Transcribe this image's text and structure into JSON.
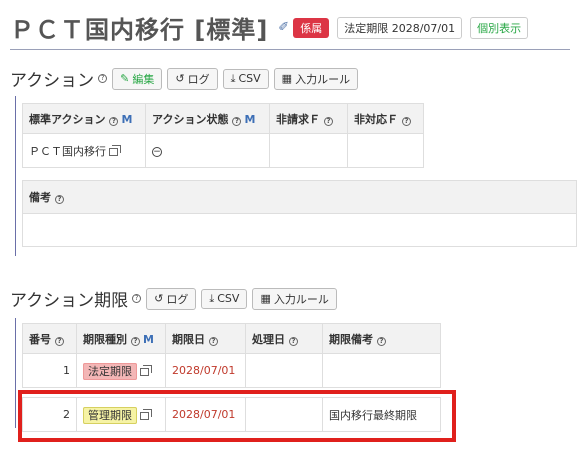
{
  "header": {
    "title": "ＰＣＴ国内移行 [標準]",
    "status_badge": "係属",
    "legal_deadline_label": "法定期限 2028/07/01",
    "individual_view_label": "個別表示"
  },
  "actions_section": {
    "title": "アクション",
    "buttons": {
      "edit": "編集",
      "log": "ログ",
      "csv": "CSV",
      "input_rule": "入力ルール"
    },
    "columns": {
      "standard_action": "標準アクション",
      "action_status": "アクション状態",
      "non_claim": "非請求Ｆ",
      "non_response": "非対応Ｆ",
      "m_marker": "M"
    },
    "row": {
      "standard_action": "ＰＣＴ国内移行",
      "action_status_icon": "minus-circle-icon"
    },
    "remarks_label": "備考"
  },
  "deadlines_section": {
    "title": "アクション期限",
    "buttons": {
      "log": "ログ",
      "csv": "CSV",
      "input_rule": "入力ルール"
    },
    "columns": {
      "number": "番号",
      "deadline_type": "期限種別",
      "deadline_date": "期限日",
      "processed_date": "処理日",
      "remarks": "期限備考",
      "m_marker": "M"
    },
    "rows": [
      {
        "number": "1",
        "type": "法定期限",
        "type_color": "#f3b6b6",
        "date": "2028/07/01",
        "processed": "",
        "remarks": ""
      },
      {
        "number": "2",
        "type": "管理期限",
        "type_color": "#f6f3a5",
        "date": "2028/07/01",
        "processed": "",
        "remarks": "国内移行最終期限"
      }
    ]
  },
  "colors": {
    "accent_red": "#dc3545",
    "date_red": "#c0392b",
    "highlight": "#e0201c"
  }
}
